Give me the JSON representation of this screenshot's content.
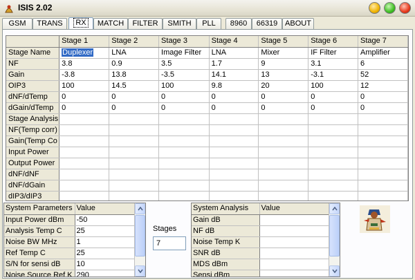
{
  "window": {
    "title": "ISIS 2.02"
  },
  "tabs": [
    {
      "label": "GSM",
      "active": false
    },
    {
      "label": "TRANS",
      "active": false
    },
    {
      "label": "RX",
      "active": true
    },
    {
      "label": "MATCH",
      "active": false
    },
    {
      "label": "FILTER",
      "active": false
    },
    {
      "label": "SMITH",
      "active": false
    },
    {
      "label": "PLL",
      "active": false
    },
    {
      "label": "8960",
      "active": false
    },
    {
      "label": "66319",
      "active": false
    },
    {
      "label": "ABOUT",
      "active": false
    }
  ],
  "stage_grid": {
    "columns": [
      "Stage 1",
      "Stage 2",
      "Stage 3",
      "Stage 4",
      "Stage 5",
      "Stage 6",
      "Stage 7"
    ],
    "rows": [
      {
        "label": "Stage Name",
        "values": [
          "Duplexer",
          "LNA",
          "Image Filter",
          "LNA",
          "Mixer",
          "IF Filter",
          "Amplifier"
        ]
      },
      {
        "label": "NF",
        "values": [
          "3.8",
          "0.9",
          "3.5",
          "1.7",
          "9",
          "3.1",
          "6"
        ]
      },
      {
        "label": "Gain",
        "values": [
          "-3.8",
          "13.8",
          "-3.5",
          "14.1",
          "13",
          "-3.1",
          "52"
        ]
      },
      {
        "label": "OIP3",
        "values": [
          "100",
          "14.5",
          "100",
          "9.8",
          "20",
          "100",
          "12"
        ]
      },
      {
        "label": "dNF/dTemp",
        "values": [
          "0",
          "0",
          "0",
          "0",
          "0",
          "0",
          "0"
        ]
      },
      {
        "label": "dGain/dTemp",
        "values": [
          "0",
          "0",
          "0",
          "0",
          "0",
          "0",
          "0"
        ]
      },
      {
        "label": "Stage Analysis",
        "values": [
          "",
          "",
          "",
          "",
          "",
          "",
          ""
        ]
      },
      {
        "label": "NF(Temp corr)",
        "values": [
          "",
          "",
          "",
          "",
          "",
          "",
          ""
        ]
      },
      {
        "label": "Gain(Temp Co",
        "values": [
          "",
          "",
          "",
          "",
          "",
          "",
          ""
        ]
      },
      {
        "label": "Input Power",
        "values": [
          "",
          "",
          "",
          "",
          "",
          "",
          ""
        ]
      },
      {
        "label": "Output Power",
        "values": [
          "",
          "",
          "",
          "",
          "",
          "",
          ""
        ]
      },
      {
        "label": "dNF/dNF",
        "values": [
          "",
          "",
          "",
          "",
          "",
          "",
          ""
        ]
      },
      {
        "label": "dNF/dGain",
        "values": [
          "",
          "",
          "",
          "",
          "",
          "",
          ""
        ]
      },
      {
        "label": "dIP3/dIP3",
        "values": [
          "",
          "",
          "",
          "",
          "",
          "",
          ""
        ]
      }
    ]
  },
  "system_parameters": {
    "headers": [
      "System Parameters",
      "Value"
    ],
    "rows": [
      {
        "label": "Input Power dBm",
        "value": "-50"
      },
      {
        "label": "Analysis Temp C",
        "value": "25"
      },
      {
        "label": "Noise BW MHz",
        "value": "1"
      },
      {
        "label": "Ref Temp C",
        "value": "25"
      },
      {
        "label": "S/N for sensi dB",
        "value": "10"
      },
      {
        "label": "Noise Source Ref K",
        "value": "290"
      }
    ]
  },
  "stages": {
    "label": "Stages",
    "value": "7"
  },
  "system_analysis": {
    "headers": [
      "System Analysis",
      "Value"
    ],
    "rows": [
      {
        "label": "Gain dB",
        "value": ""
      },
      {
        "label": "NF dB",
        "value": ""
      },
      {
        "label": "Noise Temp K",
        "value": ""
      },
      {
        "label": "SNR dB",
        "value": ""
      },
      {
        "label": "MDS dBm",
        "value": ""
      },
      {
        "label": "Sensi dBm",
        "value": ""
      }
    ]
  },
  "colors": {
    "selection": "#316ac5",
    "face": "#ece9d8",
    "grid_line": "#c0c0c0"
  }
}
